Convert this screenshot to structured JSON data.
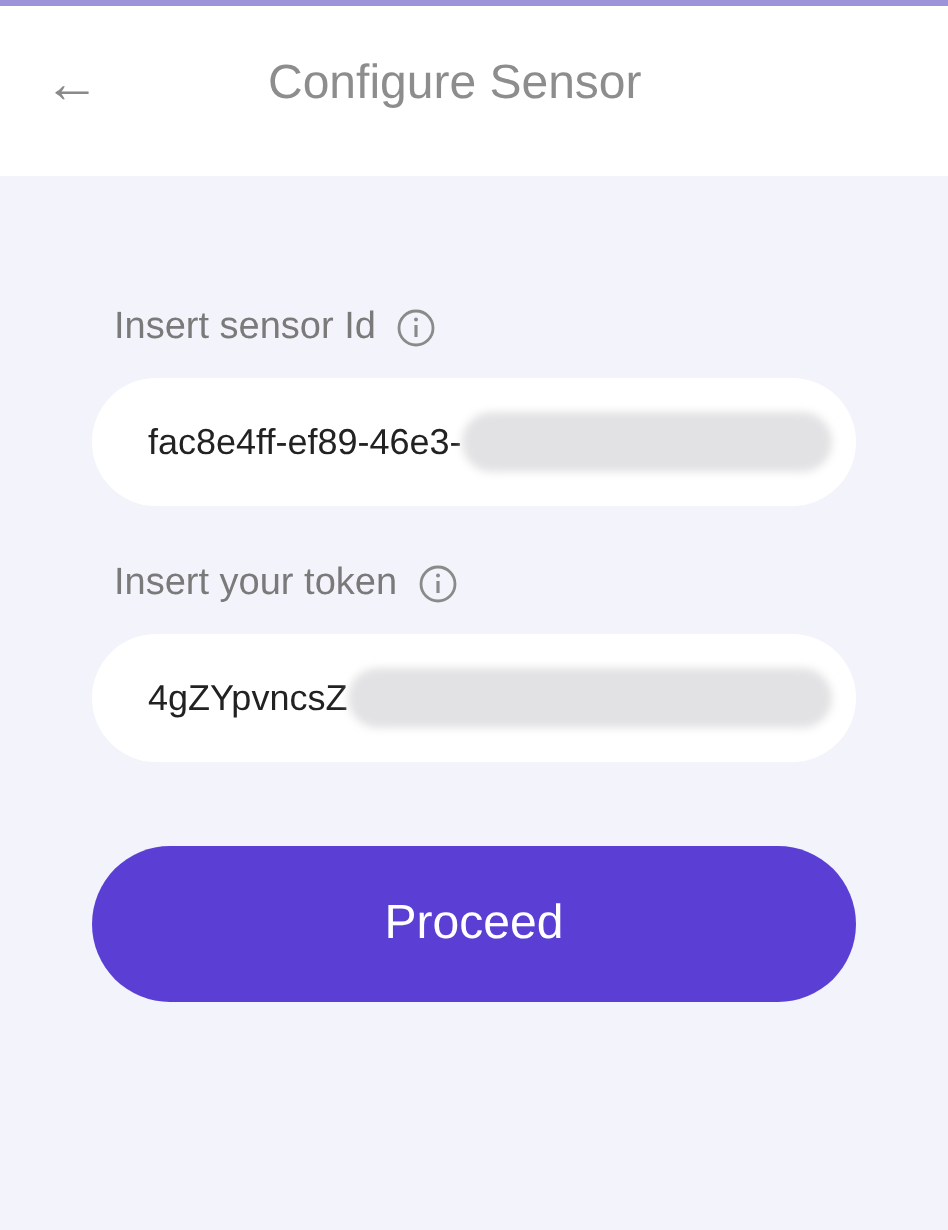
{
  "header": {
    "back_icon": "←",
    "title": "Configure Sensor"
  },
  "fields": [
    {
      "label": "Insert sensor Id",
      "value": "fac8e4ff-ef89-46e3-",
      "redacted": true
    },
    {
      "label": "Insert your token",
      "value": "4gZYpvncsZ",
      "redacted": true
    }
  ],
  "button": "Proceed"
}
